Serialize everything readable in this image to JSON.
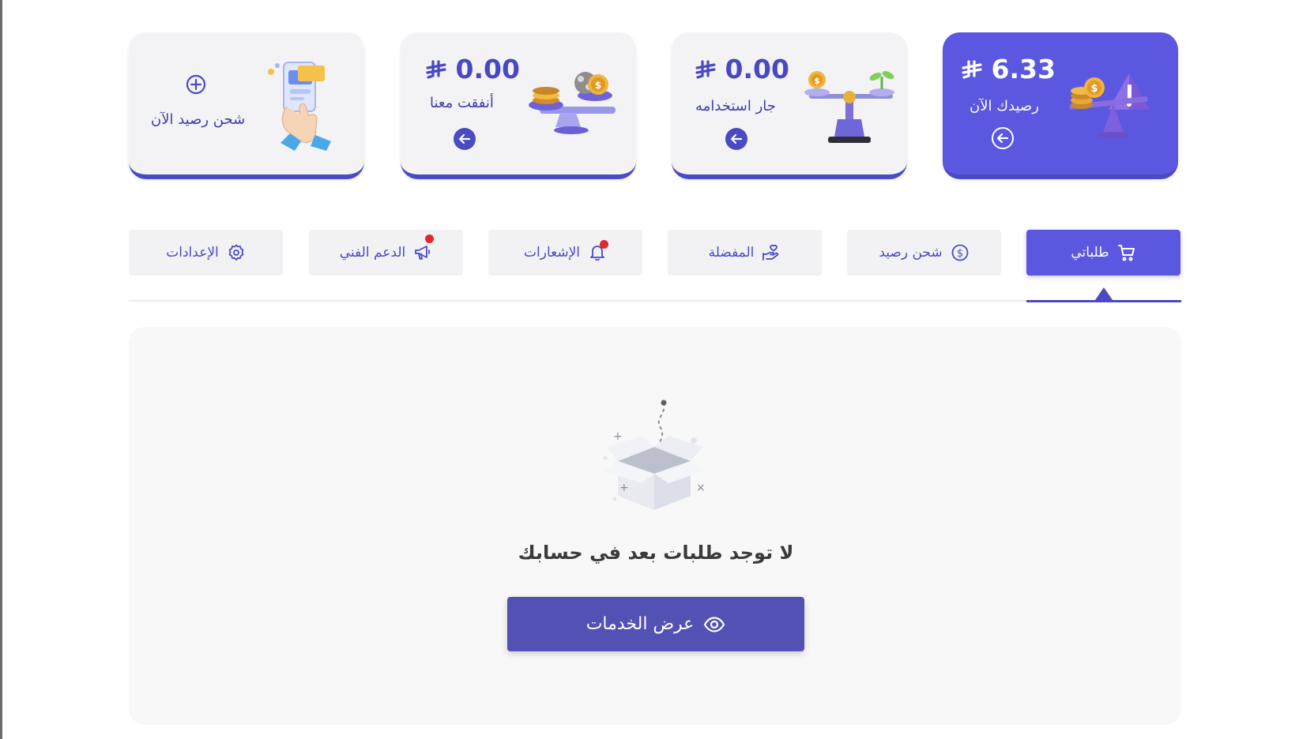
{
  "stat_cards": [
    {
      "amount": "6.33",
      "label": "رصيدك الآن",
      "active": true
    },
    {
      "amount": "0.00",
      "label": "جار استخدامه",
      "active": false
    },
    {
      "amount": "0.00",
      "label": "أنفقت معنا",
      "active": false
    },
    {
      "label": "شحن رصيد الآن",
      "active": false
    }
  ],
  "currency_icon": "riyal-sign-icon",
  "tabs": [
    {
      "label": "طلباتي",
      "icon": "cart-icon",
      "active": true
    },
    {
      "label": "شحن رصيد",
      "icon": "dollar-circle-icon",
      "active": false
    },
    {
      "label": "المفضلة",
      "icon": "hand-heart-icon",
      "active": false
    },
    {
      "label": "الإشعارات",
      "icon": "bell-icon",
      "active": false,
      "badge": true
    },
    {
      "label": "الدعم الفني",
      "icon": "megaphone-icon",
      "active": false,
      "badge": true
    },
    {
      "label": "الإعدادات",
      "icon": "gear-icon",
      "active": false
    }
  ],
  "empty_state": {
    "message": "لا توجد طلبات بعد في حسابك",
    "button_label": "عرض الخدمات",
    "button_icon": "eye-icon"
  },
  "colors": {
    "primary": "#5b57e0",
    "primary_dark": "#4a4ac2",
    "button": "#5351b3",
    "badge": "#e0282e"
  }
}
